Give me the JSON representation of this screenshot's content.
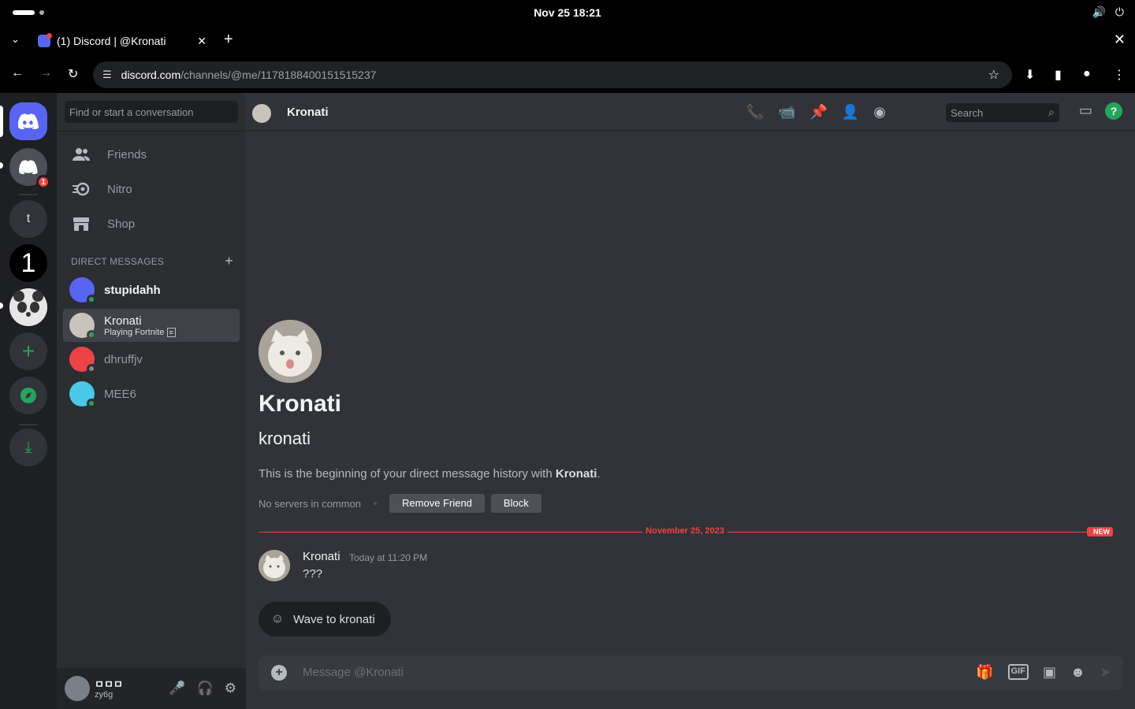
{
  "os": {
    "clock": "Nov 25  18:21",
    "volume_icon": "volume-icon",
    "power_icon": "power-icon"
  },
  "browser": {
    "tab_title": "(1) Discord | @Kronati",
    "url_host": "discord.com",
    "url_path": "/channels/@me/1178188400151515237"
  },
  "rail": {
    "home_badge": "1",
    "servers": [
      "t",
      "1"
    ]
  },
  "dm_sidebar": {
    "search_placeholder": "Find or start a conversation",
    "nav": [
      {
        "label": "Friends",
        "icon": "friends-icon"
      },
      {
        "label": "Nitro",
        "icon": "nitro-icon"
      },
      {
        "label": "Shop",
        "icon": "shop-icon"
      }
    ],
    "section_title": "DIRECT MESSAGES",
    "dms": [
      {
        "name": "stupidahh",
        "status": "online",
        "avatar_color": "#5865f2"
      },
      {
        "name": "Kronati",
        "subtitle": "Playing Fortnite",
        "status": "online",
        "active": true
      },
      {
        "name": "dhruffjv",
        "status": "offline",
        "avatar_color": "#ed4245"
      },
      {
        "name": "MEE6",
        "status": "online",
        "avatar_color": "#49c8e8"
      }
    ]
  },
  "user_panel": {
    "display_name": "ㅁㅁㅁ",
    "username": "zy6g"
  },
  "chat": {
    "header_name": "Kronati",
    "search_placeholder": "Search",
    "intro_name": "Kronati",
    "intro_username": "kronati",
    "intro_text_prefix": "This is the beginning of your direct message history with ",
    "intro_text_bold": "Kronati",
    "intro_text_suffix": ".",
    "mutual": "No servers in common",
    "remove_friend": "Remove Friend",
    "block": "Block",
    "divider_date": "November 25, 2023",
    "new_tag": "NEW",
    "message": {
      "author": "Kronati",
      "timestamp": "Today at 11:20 PM",
      "text": "???"
    },
    "wave_label": "Wave to kronati",
    "composer_placeholder": "Message @Kronati"
  },
  "colors": {
    "blurple": "#5865f2",
    "online": "#23a55a",
    "danger": "#f23f43"
  }
}
